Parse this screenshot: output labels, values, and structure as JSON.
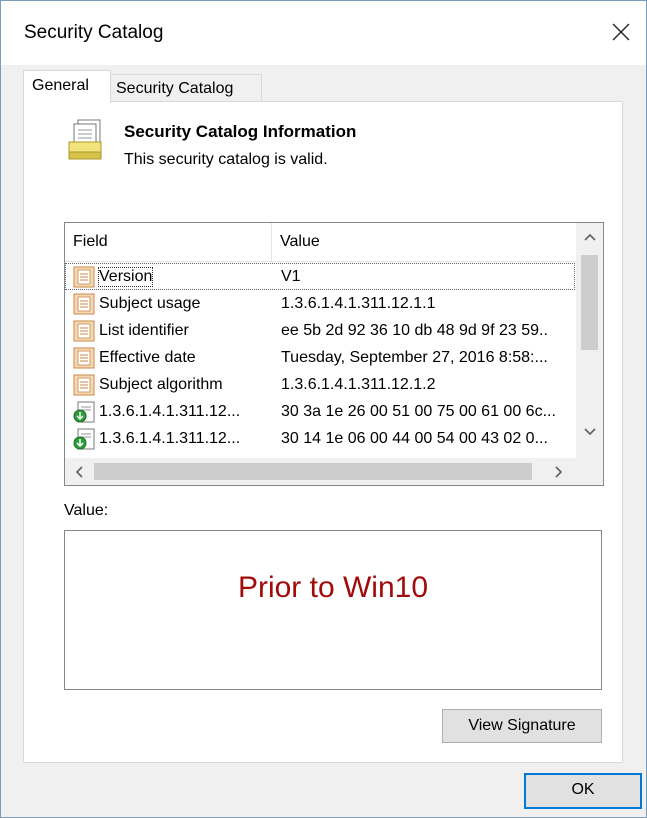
{
  "window": {
    "title": "Security Catalog"
  },
  "tabs": [
    {
      "label": "General",
      "active": true
    },
    {
      "label": "Security Catalog",
      "active": false
    }
  ],
  "info": {
    "icon": "certificate-document-icon",
    "title": "Security Catalog Information",
    "subtitle": "This security catalog is valid."
  },
  "listview": {
    "columns": [
      "Field",
      "Value"
    ],
    "rows": [
      {
        "icon": "field-icon",
        "field": "Version",
        "value": "V1",
        "selected": true
      },
      {
        "icon": "field-icon",
        "field": "Subject usage",
        "value": "1.3.6.1.4.1.311.12.1.1"
      },
      {
        "icon": "field-icon",
        "field": "List identifier",
        "value": "ee 5b 2d 92 36 10 db 48 9d 9f 23 59.."
      },
      {
        "icon": "field-icon",
        "field": "Effective date",
        "value": "Tuesday, September 27, 2016 8:58:..."
      },
      {
        "icon": "field-icon",
        "field": "Subject algorithm",
        "value": "1.3.6.1.4.1.311.12.1.2"
      },
      {
        "icon": "extension-icon",
        "field": "1.3.6.1.4.1.311.12...",
        "value": "30 3a 1e 26 00 51 00 75 00 61 00 6c..."
      },
      {
        "icon": "extension-icon",
        "field": "1.3.6.1.4.1.311.12...",
        "value": "30 14 1e 06 00 44 00 54 00 43 02 0..."
      }
    ]
  },
  "value_section": {
    "label": "Value:",
    "content": "Prior to Win10",
    "content_color": "#a10b0b"
  },
  "buttons": {
    "view_signature": "View Signature",
    "ok": "OK"
  },
  "icons": {
    "close": "close-icon",
    "scroll_up": "chevron-up-icon",
    "scroll_down": "chevron-down-icon",
    "scroll_left": "chevron-left-icon",
    "scroll_right": "chevron-right-icon"
  }
}
